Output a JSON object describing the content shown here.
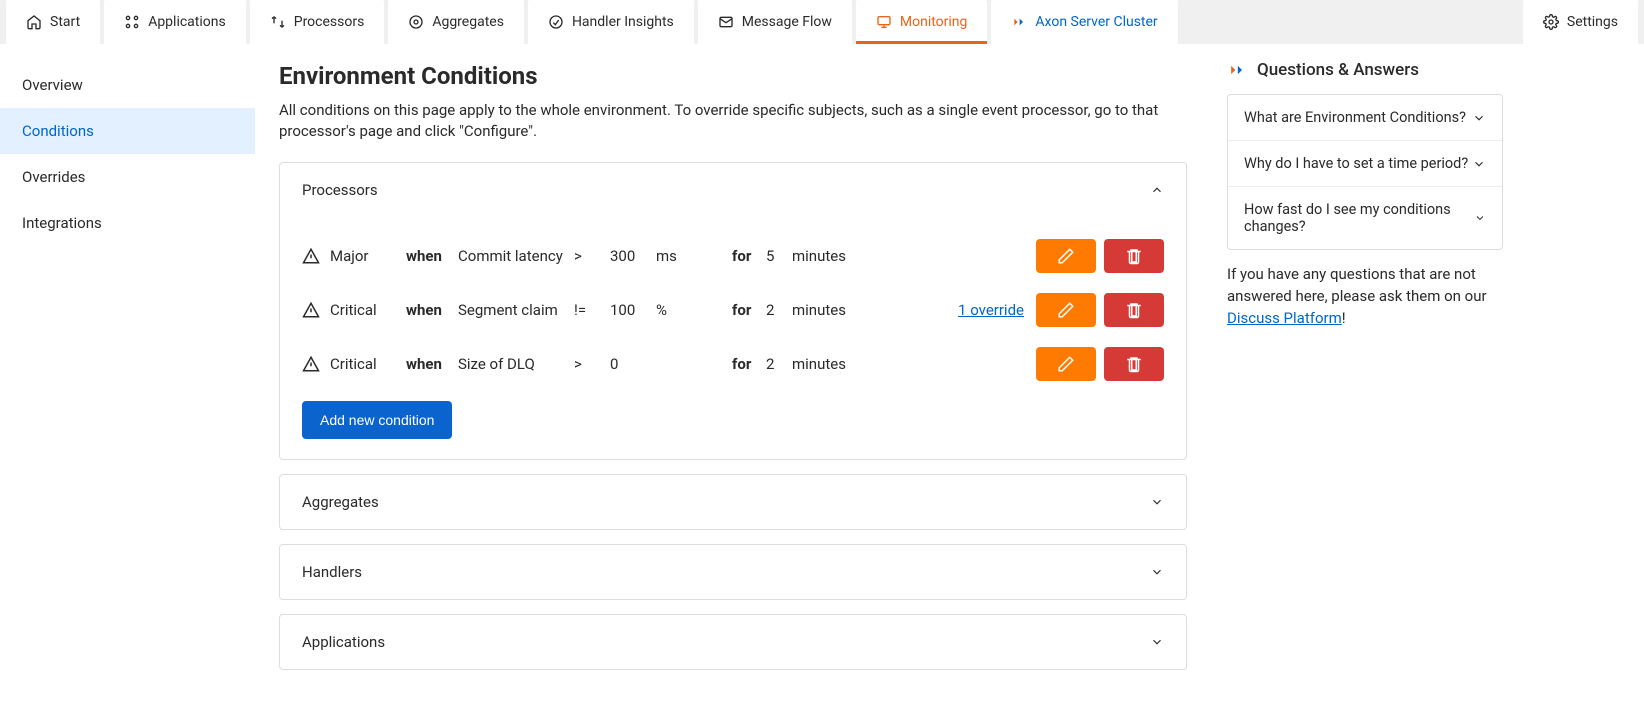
{
  "topnav": {
    "tabs": [
      {
        "label": "Start"
      },
      {
        "label": "Applications"
      },
      {
        "label": "Processors"
      },
      {
        "label": "Aggregates"
      },
      {
        "label": "Handler Insights"
      },
      {
        "label": "Message Flow"
      },
      {
        "label": "Monitoring",
        "active": true
      },
      {
        "label": "Axon Server Cluster",
        "axon": true
      }
    ],
    "settings_label": "Settings"
  },
  "sidebar": {
    "items": [
      {
        "label": "Overview"
      },
      {
        "label": "Conditions",
        "active": true
      },
      {
        "label": "Overrides"
      },
      {
        "label": "Integrations"
      }
    ]
  },
  "page": {
    "title": "Environment Conditions",
    "intro": "All conditions on this page apply to the whole environment. To override specific subjects, such as a single event processor, go to that processor's page and click \"Configure\"."
  },
  "panels": {
    "processors": {
      "title": "Processors",
      "conditions": [
        {
          "severity": "Major",
          "when": "when",
          "metric": "Commit latency",
          "op": ">",
          "value": "300",
          "unit": "ms",
          "for": "for",
          "dur": "5",
          "durunit": "minutes",
          "override": ""
        },
        {
          "severity": "Critical",
          "when": "when",
          "metric": "Segment claim",
          "op": "!=",
          "value": "100",
          "unit": "%",
          "for": "for",
          "dur": "2",
          "durunit": "minutes",
          "override": "1 override"
        },
        {
          "severity": "Critical",
          "when": "when",
          "metric": "Size of DLQ",
          "op": ">",
          "value": "0",
          "unit": "",
          "for": "for",
          "dur": "2",
          "durunit": "minutes",
          "override": ""
        }
      ],
      "add_label": "Add new condition"
    },
    "aggregates": {
      "title": "Aggregates"
    },
    "handlers": {
      "title": "Handlers"
    },
    "applications": {
      "title": "Applications"
    }
  },
  "qa": {
    "heading": "Questions & Answers",
    "items": [
      {
        "q": "What are Environment Conditions?"
      },
      {
        "q": "Why do I have to set a time period?"
      },
      {
        "q": "How fast do I see my conditions changes?"
      }
    ],
    "note_prefix": "If you have any questions that are not answered here, please ask them on our ",
    "note_link": "Discuss Platform",
    "note_suffix": "!"
  }
}
